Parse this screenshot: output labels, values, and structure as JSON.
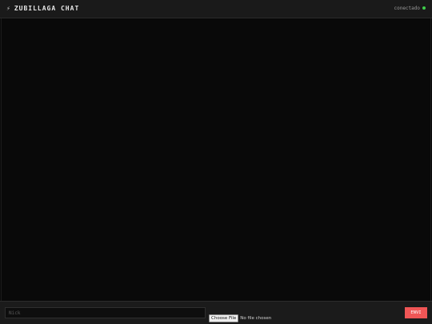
{
  "header": {
    "icon": "bolt-icon",
    "icon_glyph": "⚡",
    "title": "ZUBILLAGA CHAT",
    "status_text": "conectado",
    "status_color": "#3ecf4a"
  },
  "composer": {
    "nick_placeholder": "Nick",
    "file_button_label": "Choose File",
    "file_status": "No file chosen",
    "send_label": "ENVI",
    "send_color": "#f05656"
  }
}
